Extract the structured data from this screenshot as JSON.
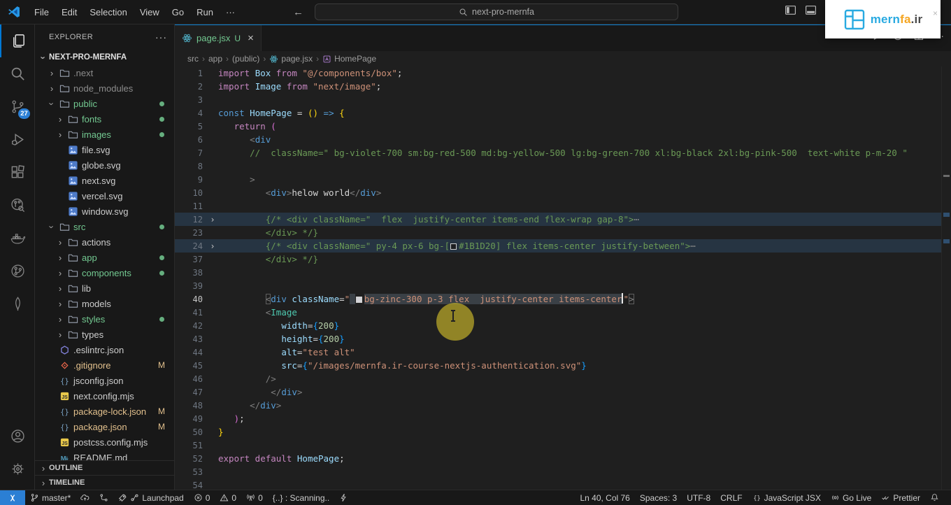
{
  "title_bar": {
    "menus": [
      "File",
      "Edit",
      "Selection",
      "View",
      "Go",
      "Run"
    ],
    "more_label": "···",
    "back": "←",
    "forward": "→",
    "search_value": "next-pro-mernfa"
  },
  "brand_overlay": {
    "name_primary": "mern",
    "name_accent": "fa",
    "name_suffix": ".ir",
    "close": "×"
  },
  "activity_bar": {
    "badge": "27",
    "top": [
      {
        "name": "explorer",
        "icon": "files",
        "active": true
      },
      {
        "name": "search",
        "icon": "search"
      },
      {
        "name": "source-control",
        "icon": "scm",
        "badge": "27"
      },
      {
        "name": "run-debug",
        "icon": "debug"
      },
      {
        "name": "extensions",
        "icon": "extensions"
      },
      {
        "name": "remote-graph",
        "icon": "scope"
      },
      {
        "name": "docker",
        "icon": "docker"
      },
      {
        "name": "gitlens",
        "icon": "gitlens"
      },
      {
        "name": "mongodb",
        "icon": "mongo"
      }
    ],
    "bottom": [
      {
        "name": "account",
        "icon": "account"
      },
      {
        "name": "settings",
        "icon": "gear"
      }
    ]
  },
  "explorer": {
    "title": "EXPLORER",
    "actions": "···",
    "project": "NEXT-PRO-MERNFA",
    "items": [
      {
        "label": ".next",
        "icon": "folder",
        "level": 0,
        "chev": "right",
        "cls": "dim"
      },
      {
        "label": "node_modules",
        "icon": "folder",
        "level": 0,
        "chev": "right",
        "cls": "dim"
      },
      {
        "label": "public",
        "icon": "folder",
        "level": 0,
        "chev": "down",
        "cls": "green",
        "dot": true
      },
      {
        "label": "fonts",
        "icon": "folder",
        "level": 1,
        "chev": "right",
        "cls": "green",
        "dot": true
      },
      {
        "label": "images",
        "icon": "folder",
        "level": 1,
        "chev": "right",
        "cls": "green",
        "dot": true
      },
      {
        "label": "file.svg",
        "icon": "image",
        "level": 1,
        "file": true,
        "cls": ""
      },
      {
        "label": "globe.svg",
        "icon": "image",
        "level": 1,
        "file": true,
        "cls": ""
      },
      {
        "label": "next.svg",
        "icon": "image",
        "level": 1,
        "file": true,
        "cls": ""
      },
      {
        "label": "vercel.svg",
        "icon": "image",
        "level": 1,
        "file": true,
        "cls": ""
      },
      {
        "label": "window.svg",
        "icon": "image",
        "level": 1,
        "file": true,
        "cls": ""
      },
      {
        "label": "src",
        "icon": "folder",
        "level": 0,
        "chev": "down",
        "cls": "green",
        "dot": true
      },
      {
        "label": "actions",
        "icon": "folder",
        "level": 1,
        "chev": "right",
        "cls": ""
      },
      {
        "label": "app",
        "icon": "folder",
        "level": 1,
        "chev": "right",
        "cls": "green",
        "dot": true
      },
      {
        "label": "components",
        "icon": "folder",
        "level": 1,
        "chev": "right",
        "cls": "green",
        "dot": true
      },
      {
        "label": "lib",
        "icon": "folder",
        "level": 1,
        "chev": "right",
        "cls": ""
      },
      {
        "label": "models",
        "icon": "folder",
        "level": 1,
        "chev": "right",
        "cls": ""
      },
      {
        "label": "styles",
        "icon": "folder",
        "level": 1,
        "chev": "right",
        "cls": "green",
        "dot": true
      },
      {
        "label": "types",
        "icon": "folder",
        "level": 1,
        "chev": "right",
        "cls": ""
      },
      {
        "label": ".eslintrc.json",
        "icon": "eslint",
        "level": 0,
        "file": true,
        "cls": ""
      },
      {
        "label": ".gitignore",
        "icon": "git",
        "level": 0,
        "file": true,
        "cls": "mod",
        "m": "M"
      },
      {
        "label": "jsconfig.json",
        "icon": "braces",
        "level": 0,
        "file": true,
        "cls": ""
      },
      {
        "label": "next.config.mjs",
        "icon": "js",
        "level": 0,
        "file": true,
        "cls": ""
      },
      {
        "label": "package-lock.json",
        "icon": "braces",
        "level": 0,
        "file": true,
        "cls": "mod",
        "m": "M"
      },
      {
        "label": "package.json",
        "icon": "braces",
        "level": 0,
        "file": true,
        "cls": "mod",
        "m": "M"
      },
      {
        "label": "postcss.config.mjs",
        "icon": "js",
        "level": 0,
        "file": true,
        "cls": ""
      },
      {
        "label": "README.md",
        "icon": "md",
        "level": 0,
        "file": true,
        "cls": ""
      }
    ],
    "sections": [
      "OUTLINE",
      "TIMELINE"
    ]
  },
  "editor": {
    "tab": {
      "label": "page.jsx",
      "badge": "U",
      "close": "×"
    },
    "breadcrumbs": [
      {
        "label": "src"
      },
      {
        "label": "app"
      },
      {
        "label": "(public)"
      },
      {
        "label": "page.jsx",
        "icon": "react"
      },
      {
        "label": "HomePage",
        "icon": "symbol"
      }
    ],
    "actions": [
      "play",
      "runcircle",
      "split"
    ],
    "actions_more": "···",
    "lines": [
      {
        "n": 1,
        "t": [
          [
            "k",
            "import "
          ],
          [
            "v",
            "Box"
          ],
          [
            "k",
            " from "
          ],
          [
            "st",
            "\"@/components/box\""
          ],
          [
            "p",
            ";"
          ]
        ]
      },
      {
        "n": 2,
        "t": [
          [
            "k",
            "import "
          ],
          [
            "v",
            "Image"
          ],
          [
            "k",
            " from "
          ],
          [
            "st",
            "\"next/image\""
          ],
          [
            "p",
            ";"
          ]
        ]
      },
      {
        "n": 3,
        "t": []
      },
      {
        "n": 4,
        "t": [
          [
            "s",
            "const "
          ],
          [
            "f",
            "HomePage"
          ],
          [
            "p",
            " = "
          ],
          [
            "b1",
            "()"
          ],
          [
            "p",
            " "
          ],
          [
            "s",
            "=>"
          ],
          [
            "p",
            " "
          ],
          [
            "b1",
            "{"
          ]
        ]
      },
      {
        "n": 5,
        "t": [
          [
            "tx",
            "   "
          ],
          [
            "k",
            "return"
          ],
          [
            "p",
            " "
          ],
          [
            "b2",
            "("
          ]
        ]
      },
      {
        "n": 6,
        "t": [
          [
            "tx",
            "      "
          ],
          [
            "tb",
            "<"
          ],
          [
            "tg",
            "div"
          ]
        ]
      },
      {
        "n": 7,
        "t": [
          [
            "tx",
            "      "
          ],
          [
            "c",
            "//  className=\" bg-violet-700 sm:bg-red-500 md:bg-yellow-500 lg:bg-green-700 xl:bg-black 2xl:bg-pink-500  text-white p-m-20 \""
          ]
        ]
      },
      {
        "n": 8,
        "t": []
      },
      {
        "n": 9,
        "t": [
          [
            "tx",
            "      "
          ],
          [
            "tb",
            ">"
          ]
        ]
      },
      {
        "n": 10,
        "t": [
          [
            "tx",
            "         "
          ],
          [
            "tb",
            "<"
          ],
          [
            "tg",
            "div"
          ],
          [
            "tb",
            ">"
          ],
          [
            "tx",
            "helow world"
          ],
          [
            "tb",
            "</"
          ],
          [
            "tg",
            "div"
          ],
          [
            "tb",
            ">"
          ]
        ]
      },
      {
        "n": 11,
        "t": []
      },
      {
        "n": 12,
        "f": 1,
        "h": 1,
        "t": [
          [
            "tx",
            "         "
          ],
          [
            "c",
            "{/* <div className=\"  flex  justify-center items-end flex-wrap gap-8\">"
          ],
          [
            "e",
            "⋯"
          ]
        ]
      },
      {
        "n": 23,
        "t": [
          [
            "tx",
            "         "
          ],
          [
            "c",
            "</div> */}"
          ]
        ]
      },
      {
        "n": 24,
        "f": 1,
        "h": 1,
        "t": [
          [
            "tx",
            "         "
          ],
          [
            "c",
            "{/* <div className=\" py-4 px-6 bg-["
          ],
          [
            "sw",
            "#1B1D20"
          ],
          [
            "c",
            "#1B1D20] flex items-center justify-between\">"
          ],
          [
            "e",
            "⋯"
          ]
        ]
      },
      {
        "n": 37,
        "t": [
          [
            "tx",
            "         "
          ],
          [
            "c",
            "</div> */}"
          ]
        ]
      },
      {
        "n": 38,
        "t": []
      },
      {
        "n": 39,
        "t": []
      },
      {
        "n": 40,
        "t": [
          [
            "tx",
            "         "
          ],
          [
            "tb",
            "<",
            0,
            1
          ],
          [
            "tg",
            "div"
          ],
          [
            "p",
            " "
          ],
          [
            "v",
            "className"
          ],
          [
            "p",
            "="
          ],
          [
            "st",
            "\""
          ],
          [
            "st",
            " ",
            1
          ],
          [
            "sw",
            "#d4d4d8",
            1
          ],
          [
            "st",
            "bg-zinc-300 p-3 flex  justify-center items-center",
            1
          ],
          [
            "cur",
            ""
          ],
          [
            "st",
            "\""
          ],
          [
            "tb",
            ">",
            0,
            1
          ]
        ]
      },
      {
        "n": 41,
        "t": [
          [
            "tx",
            "         "
          ],
          [
            "tb",
            "<"
          ],
          [
            "cp",
            "Image"
          ]
        ]
      },
      {
        "n": 42,
        "t": [
          [
            "tx",
            "            "
          ],
          [
            "v",
            "width"
          ],
          [
            "p",
            "="
          ],
          [
            "b3",
            "{"
          ],
          [
            "n",
            "200"
          ],
          [
            "b3",
            "}"
          ]
        ]
      },
      {
        "n": 43,
        "t": [
          [
            "tx",
            "            "
          ],
          [
            "v",
            "height"
          ],
          [
            "p",
            "="
          ],
          [
            "b3",
            "{"
          ],
          [
            "n",
            "200"
          ],
          [
            "b3",
            "}"
          ]
        ]
      },
      {
        "n": 44,
        "t": [
          [
            "tx",
            "            "
          ],
          [
            "v",
            "alt"
          ],
          [
            "p",
            "="
          ],
          [
            "st",
            "\"test alt\""
          ]
        ]
      },
      {
        "n": 45,
        "t": [
          [
            "tx",
            "            "
          ],
          [
            "v",
            "src"
          ],
          [
            "p",
            "="
          ],
          [
            "b3",
            "{"
          ],
          [
            "st",
            "\"/images/mernfa.ir-course-nextjs-authentication.svg\""
          ],
          [
            "b3",
            "}"
          ]
        ]
      },
      {
        "n": 46,
        "t": [
          [
            "tx",
            "         "
          ],
          [
            "tb",
            "/>"
          ]
        ]
      },
      {
        "n": 47,
        "t": [
          [
            "tx",
            "          "
          ],
          [
            "tb",
            "</"
          ],
          [
            "tg",
            "div"
          ],
          [
            "tb",
            ">"
          ]
        ]
      },
      {
        "n": 48,
        "t": [
          [
            "tx",
            "      "
          ],
          [
            "tb",
            "</"
          ],
          [
            "tg",
            "div"
          ],
          [
            "tb",
            ">"
          ]
        ]
      },
      {
        "n": 49,
        "t": [
          [
            "tx",
            "   "
          ],
          [
            "b2",
            ")"
          ],
          [
            "p",
            ";"
          ]
        ]
      },
      {
        "n": 50,
        "t": [
          [
            "b1",
            "}"
          ]
        ]
      },
      {
        "n": 51,
        "t": []
      },
      {
        "n": 52,
        "t": [
          [
            "k",
            "export default "
          ],
          [
            "v",
            "HomePage"
          ],
          [
            "p",
            ";"
          ]
        ]
      },
      {
        "n": 53,
        "t": []
      },
      {
        "n": 54,
        "t": []
      }
    ]
  },
  "status_bar": {
    "left": [
      {
        "name": "git-branch",
        "icons": [
          "branch"
        ],
        "label": "master*"
      },
      {
        "name": "sync-changes",
        "icons": [
          "cloudup"
        ],
        "label": ""
      },
      {
        "name": "git-graph",
        "icons": [
          "graph"
        ],
        "label": ""
      },
      {
        "name": "launchpad",
        "icons": [
          "rocket",
          "rocket2"
        ],
        "label": "Launchpad"
      },
      {
        "name": "errors",
        "icons": [
          "error"
        ],
        "label": "0"
      },
      {
        "name": "warnings",
        "icons": [
          "warn"
        ],
        "label": "0"
      },
      {
        "name": "ports",
        "icons": [
          "broadcast"
        ],
        "label": "0"
      },
      {
        "name": "scanning",
        "icons": [],
        "label": "{..} : Scanning.."
      },
      {
        "name": "power",
        "icons": [
          "zap"
        ],
        "label": ""
      }
    ],
    "right": [
      {
        "name": "cursor-position",
        "icons": [],
        "label": "Ln 40, Col 76"
      },
      {
        "name": "indentation",
        "icons": [],
        "label": "Spaces: 3"
      },
      {
        "name": "encoding",
        "icons": [],
        "label": "UTF-8"
      },
      {
        "name": "eol",
        "icons": [],
        "label": "CRLF"
      },
      {
        "name": "language-mode",
        "icons": [
          "bracespair"
        ],
        "label": "JavaScript JSX"
      },
      {
        "name": "go-live",
        "icons": [
          "golive"
        ],
        "label": "Go Live"
      },
      {
        "name": "prettier",
        "icons": [
          "check2"
        ],
        "label": "Prettier"
      },
      {
        "name": "notifications",
        "icons": [
          "bell"
        ],
        "label": ""
      }
    ]
  }
}
